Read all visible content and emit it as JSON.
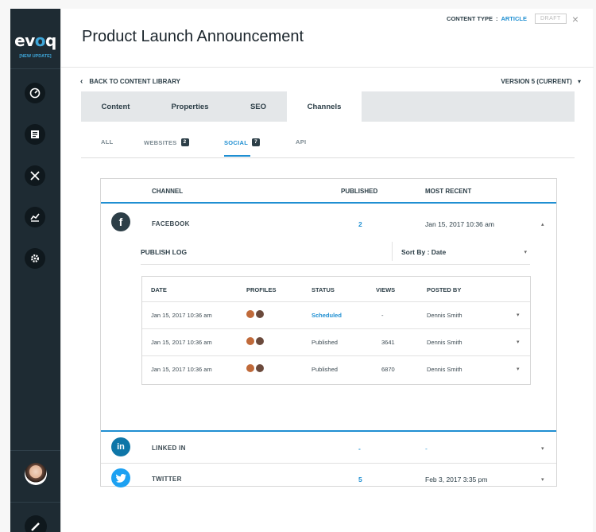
{
  "app": {
    "logo_text": "evoq",
    "logo_sub": "[NEW UPDATE]"
  },
  "colors": {
    "accent": "#1f8fd2",
    "sidebar": "#1e2b33",
    "facebook": "#3b5998",
    "linkedin": "#0e76a8",
    "twitter": "#1da1f2"
  },
  "sidebar": {
    "icons": [
      "dashboard-gauge-icon",
      "content-icon",
      "tools-icon",
      "analytics-icon",
      "settings-gear-icon"
    ]
  },
  "header": {
    "title": "Product Launch Announcement",
    "content_type_label": "CONTENT TYPE",
    "content_type_sep": ":",
    "content_type_value": "ARTICLE",
    "draft_label": "DRAFT",
    "close_glyph": "×"
  },
  "nav": {
    "back_label": "BACK TO CONTENT LIBRARY",
    "version_label": "VERSION 5 (CURRENT)"
  },
  "tabs": [
    {
      "label": "Content"
    },
    {
      "label": "Properties"
    },
    {
      "label": "SEO"
    },
    {
      "label": "Channels"
    }
  ],
  "subtabs": {
    "all": "ALL",
    "websites": "WEBSITES",
    "websites_count": "2",
    "social": "SOCIAL",
    "social_count": "7",
    "api": "API"
  },
  "channels_table": {
    "headers": {
      "channel": "CHANNEL",
      "published": "PUBLISHED",
      "most_recent": "MOST RECENT"
    },
    "rows": [
      {
        "name": "FACEBOOK",
        "icon": "facebook-icon",
        "published": "2",
        "recent": "Jan 15, 2017  10:36 am"
      },
      {
        "name": "LINKED IN",
        "icon": "linkedin-icon",
        "published": "-",
        "recent": "-"
      },
      {
        "name": "TWITTER",
        "icon": "twitter-icon",
        "published": "5",
        "recent": "Feb 3, 2017  3:35 pm"
      }
    ]
  },
  "publish_log": {
    "title": "PUBLISH LOG",
    "sort_label": "Sort By : Date",
    "headers": {
      "date": "DATE",
      "profiles": "PROFILES",
      "status": "STATUS",
      "views": "VIEWS",
      "posted_by": "POSTED BY"
    },
    "rows": [
      {
        "date": "Jan 15, 2017  10:36 am",
        "status": "Scheduled",
        "views": "-",
        "posted_by": "Dennis Smith"
      },
      {
        "date": "Jan 15, 2017  10:36 am",
        "status": "Published",
        "views": "3641",
        "posted_by": "Dennis Smith"
      },
      {
        "date": "Jan 15, 2017  10:36 am",
        "status": "Published",
        "views": "6870",
        "posted_by": "Dennis Smith"
      }
    ]
  }
}
